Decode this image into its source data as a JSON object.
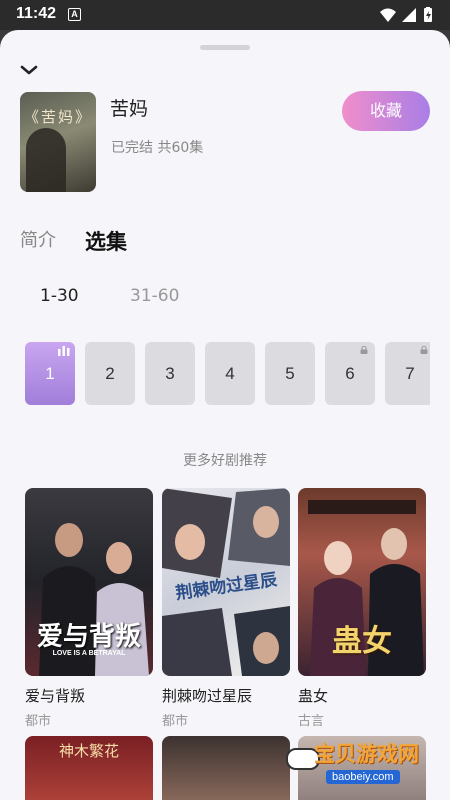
{
  "status_bar": {
    "time": "11:42",
    "notification": "A"
  },
  "drama": {
    "poster_title": "《苦妈》",
    "title": "苦妈",
    "status": "已完结 共60集",
    "favorite_label": "收藏"
  },
  "tabs": [
    {
      "label": "简介",
      "selected": false
    },
    {
      "label": "选集",
      "selected": true
    }
  ],
  "ranges": [
    {
      "label": "1-30",
      "selected": true
    },
    {
      "label": "31-60",
      "selected": false
    }
  ],
  "episodes": [
    {
      "number": "1",
      "playing": true,
      "locked": false
    },
    {
      "number": "2",
      "playing": false,
      "locked": false
    },
    {
      "number": "3",
      "playing": false,
      "locked": false
    },
    {
      "number": "4",
      "playing": false,
      "locked": false
    },
    {
      "number": "5",
      "playing": false,
      "locked": false
    },
    {
      "number": "6",
      "playing": false,
      "locked": true
    },
    {
      "number": "7",
      "playing": false,
      "locked": true
    }
  ],
  "recommend": {
    "heading": "更多好剧推荐",
    "items": [
      {
        "name": "爱与背叛",
        "genre": "都市",
        "cover_text": "爱与背叛",
        "cover_subtext": "LOVE IS A BETRAYAL"
      },
      {
        "name": "荆棘吻过星辰",
        "genre": "都市",
        "cover_text": "荆棘吻过星辰"
      },
      {
        "name": "蛊女",
        "genre": "古言",
        "cover_text": "蛊女"
      }
    ],
    "second_row": [
      {
        "cover_text": "神木繁花"
      },
      {
        "cover_text": ""
      },
      {
        "cover_text": ""
      }
    ]
  },
  "watermark": {
    "text": "宝贝游戏网",
    "url": "baobeiy.com"
  },
  "colors": {
    "accent_start": "#f08ecb",
    "accent_end": "#a97ee6",
    "sheet_bg": "#f5f5fa"
  }
}
